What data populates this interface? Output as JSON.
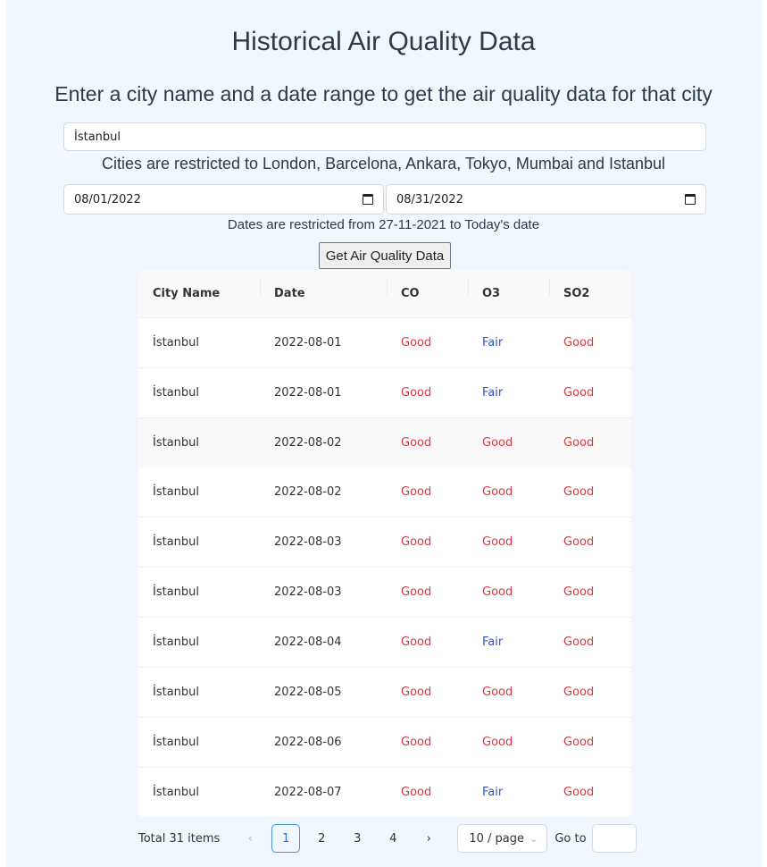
{
  "page": {
    "title": "Historical Air Quality Data",
    "subtitle": "Enter a city name and a date range to get the air quality data for that city"
  },
  "form": {
    "city_value": "İstanbul",
    "city_hint": "Cities are restricted to London, Barcelona, Ankara, Tokyo, Mumbai and Istanbul",
    "start_date": "08/01/2022",
    "end_date": "08/31/2022",
    "date_hint": "Dates are restricted from 27-11-2021 to Today's date",
    "submit_label": "Get Air Quality Data"
  },
  "table": {
    "columns": [
      "City Name",
      "Date",
      "CO",
      "O3",
      "SO2"
    ],
    "rows": [
      [
        "İstanbul",
        "2022-08-01",
        "Good",
        "Fair",
        "Good"
      ],
      [
        "İstanbul",
        "2022-08-01",
        "Good",
        "Fair",
        "Good"
      ],
      [
        "İstanbul",
        "2022-08-02",
        "Good",
        "Good",
        "Good"
      ],
      [
        "İstanbul",
        "2022-08-02",
        "Good",
        "Good",
        "Good"
      ],
      [
        "İstanbul",
        "2022-08-03",
        "Good",
        "Good",
        "Good"
      ],
      [
        "İstanbul",
        "2022-08-03",
        "Good",
        "Good",
        "Good"
      ],
      [
        "İstanbul",
        "2022-08-04",
        "Good",
        "Fair",
        "Good"
      ],
      [
        "İstanbul",
        "2022-08-05",
        "Good",
        "Good",
        "Good"
      ],
      [
        "İstanbul",
        "2022-08-06",
        "Good",
        "Good",
        "Good"
      ],
      [
        "İstanbul",
        "2022-08-07",
        "Good",
        "Fair",
        "Good"
      ]
    ]
  },
  "pagination": {
    "total": "Total 31 items",
    "prev": "‹",
    "next": "›",
    "pages": [
      "1",
      "2",
      "3",
      "4"
    ],
    "current": "1",
    "page_size": "10 / page",
    "goto_label": "Go to"
  },
  "colors": {
    "good": "#e0353d",
    "fair": "#2f54c9",
    "background": "#f0f7fe"
  }
}
